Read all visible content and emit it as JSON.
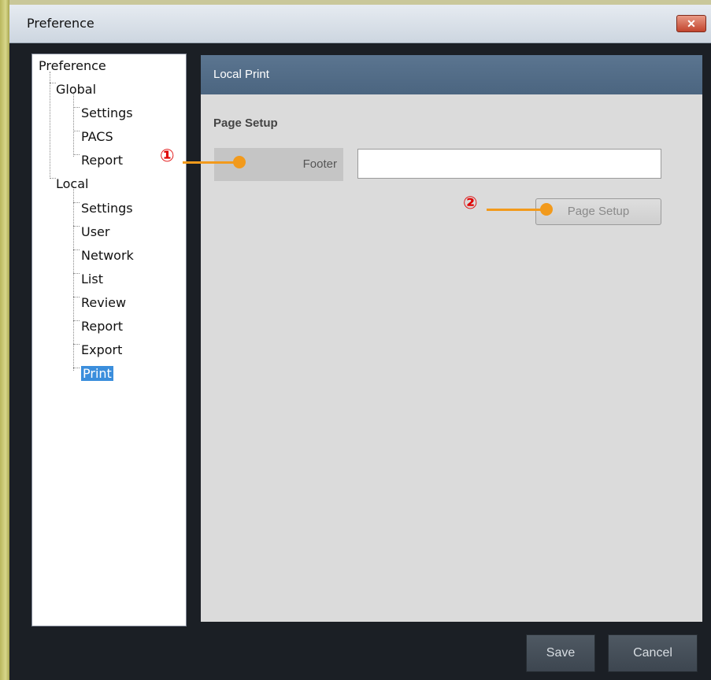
{
  "window": {
    "title": "Preference",
    "close_icon": "close-icon"
  },
  "tree": {
    "items": [
      {
        "label": "Preference"
      },
      {
        "label": "Global"
      },
      {
        "label": "Settings"
      },
      {
        "label": "PACS"
      },
      {
        "label": "Report"
      },
      {
        "label": "Local"
      },
      {
        "label": "Settings"
      },
      {
        "label": "User"
      },
      {
        "label": "Network"
      },
      {
        "label": "List"
      },
      {
        "label": "Review"
      },
      {
        "label": "Report"
      },
      {
        "label": "Export"
      },
      {
        "label": "Print",
        "selected": true
      }
    ]
  },
  "content": {
    "header": "Local Print",
    "section_title": "Page Setup",
    "footer_label": "Footer",
    "footer_value": "",
    "page_setup_button": "Page Setup"
  },
  "buttons": {
    "save": "Save",
    "cancel": "Cancel"
  },
  "annotations": {
    "marker1": "①",
    "marker2": "②",
    "accent": "#f29a1c",
    "marker_color": "#e00000"
  }
}
